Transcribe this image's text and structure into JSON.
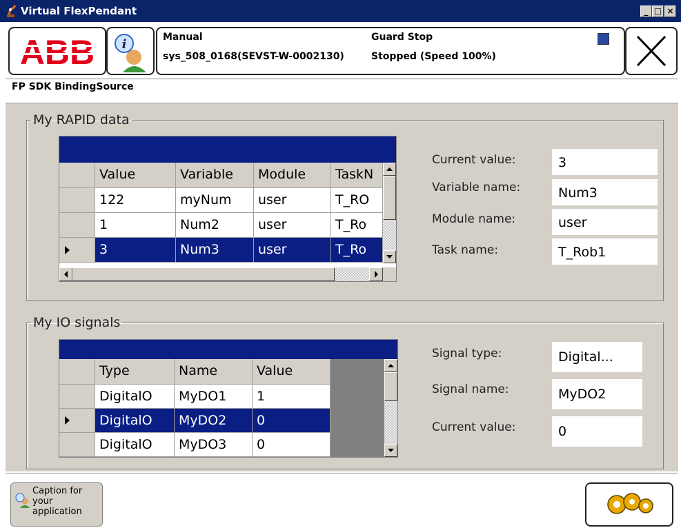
{
  "window": {
    "title": "Virtual FlexPendant"
  },
  "header": {
    "brand": "ABB",
    "mode": "Manual",
    "system": "sys_508_0168(SEVST-W-0002130)",
    "state": "Guard Stop",
    "status": "Stopped (Speed 100%)"
  },
  "app_title": "FP SDK BindingSource",
  "rapid": {
    "legend": "My RAPID data",
    "columns": [
      "Value",
      "Variable",
      "Module",
      "TaskN"
    ],
    "rows": [
      [
        "122",
        "myNum",
        "user",
        "T_RO"
      ],
      [
        "1",
        "Num2",
        "user",
        "T_Ro"
      ],
      [
        "3",
        "Num3",
        "user",
        "T_Ro"
      ]
    ],
    "labels": {
      "current": "Current value:",
      "variable": "Variable name:",
      "module": "Module name:",
      "task": "Task name:"
    },
    "values": {
      "current": "3",
      "variable": "Num3",
      "module": "user",
      "task": "T_Rob1"
    }
  },
  "io": {
    "legend": "My IO signals",
    "columns": [
      "Type",
      "Name",
      "Value"
    ],
    "rows": [
      [
        "DigitalO",
        "MyDO1",
        "1"
      ],
      [
        "DigitalO",
        "MyDO2",
        "0"
      ],
      [
        "DigitalO",
        "MyDO3",
        "0"
      ]
    ],
    "labels": {
      "type": "Signal type:",
      "name": "Signal name:",
      "current": "Current value:"
    },
    "values": {
      "type": "Digital...",
      "name": "MyDO2",
      "current": "0"
    }
  },
  "footer": {
    "caption_l1": "Caption for",
    "caption_l2": "your",
    "caption_l3": "application"
  },
  "colors": {
    "selection": "#0a1e84",
    "abb_red": "#e2001a",
    "titlebar": "#0a246a"
  }
}
